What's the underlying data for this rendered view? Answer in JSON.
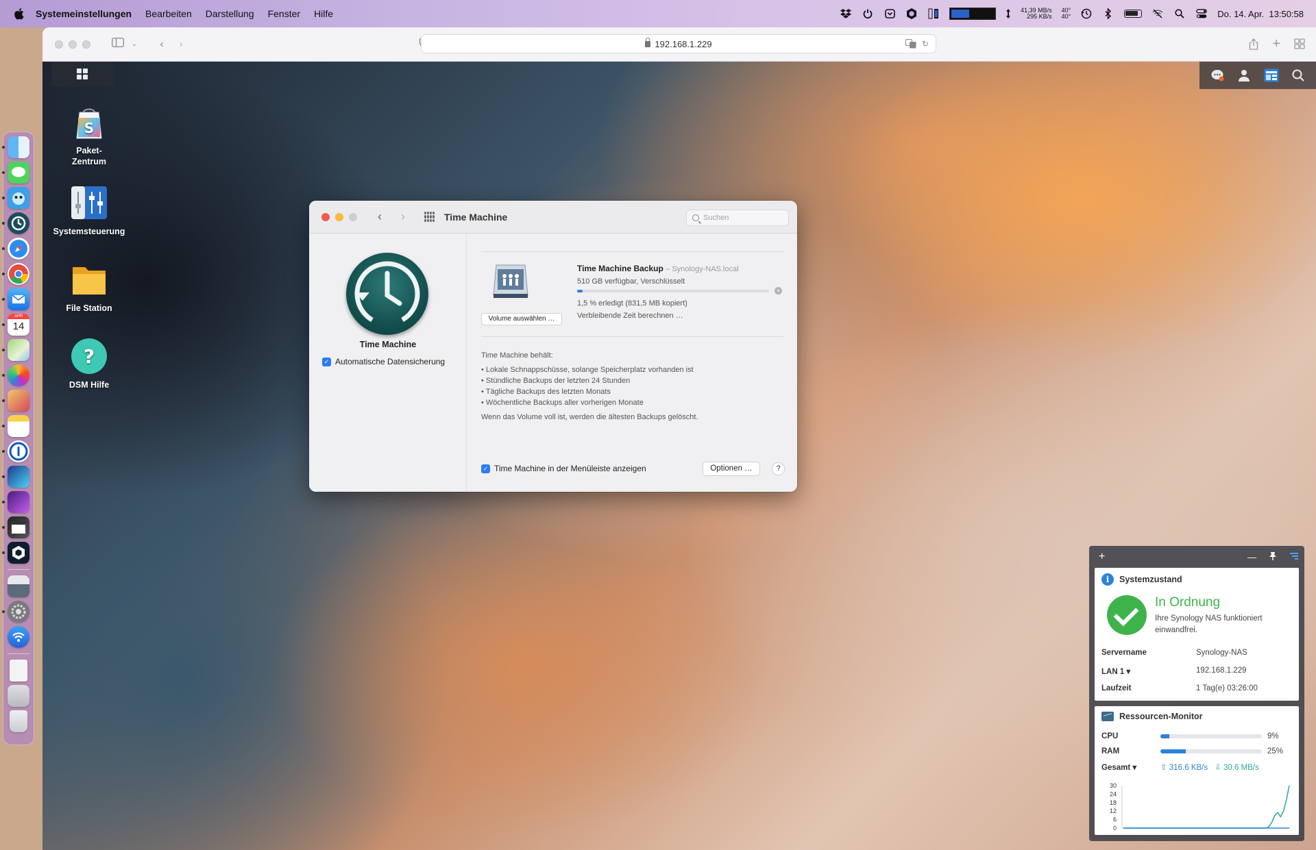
{
  "menubar": {
    "app_name": "Systemeinstellungen",
    "items": [
      "Bearbeiten",
      "Darstellung",
      "Fenster",
      "Hilfe"
    ],
    "net_up": "41,39 MB/s",
    "net_down": "295 KB/s",
    "temp1": "40°",
    "temp2": "40°",
    "datetime": "Do. 14. Apr.  13:50:58"
  },
  "browser": {
    "url": "192.168.1.229"
  },
  "dock": {
    "calendar_day": "14",
    "apps": [
      "finder-icon",
      "messages-icon",
      "tweetbot-icon",
      "time-machine-icon",
      "safari-icon",
      "chrome-icon",
      "mail-icon",
      "calendar-icon",
      "maps-icon",
      "photos-icon",
      "affinity-icon",
      "notes-icon",
      "1password-icon",
      "affinity-designer-icon",
      "affinity-photo-icon",
      "final-cut-icon",
      "sideloader-icon",
      "preview-icon",
      "system-preferences-icon",
      "wifi-icon",
      "document-icon",
      "files-icon",
      "trash-icon"
    ]
  },
  "desktop": {
    "icons": [
      {
        "label": "Paket-\nZentrum",
        "label_line1": "Paket-",
        "label_line2": "Zentrum"
      },
      {
        "label": "Systemsteuerung"
      },
      {
        "label": "File Station"
      },
      {
        "label": "DSM Hilfe"
      }
    ]
  },
  "prefs": {
    "title": "Time Machine",
    "search_placeholder": "Suchen",
    "icon_label": "Time Machine",
    "auto_backup_label": "Automatische Datensicherung",
    "auto_backup_checked": true,
    "volume_button": "Volume auswählen …",
    "backup_name": "Time Machine Backup",
    "backup_host": "– Synology-NAS.local",
    "backup_status": "510 GB verfügbar, Verschlüsselt",
    "progress_percent": 1.5,
    "progress_text": "1,5 % erledigt (831,5 MB kopiert)",
    "remaining_text": "Verbleibende Zeit berechnen …",
    "keeps_label": "Time Machine behält:",
    "keeps_items": [
      "Lokale Schnappschüsse, solange Speicherplatz vorhanden ist",
      "Stündliche Backups der letzten 24 Stunden",
      "Tägliche Backups des letzten Monats",
      "Wöchentliche Backups aller vorherigen Monate"
    ],
    "keeps_note": "Wenn das Volume voll ist, werden die ältesten Backups gelöscht.",
    "menubar_label": "Time Machine in der Menüleiste anzeigen",
    "menubar_checked": true,
    "options_button": "Optionen …",
    "help_button": "?"
  },
  "widgets": {
    "health": {
      "title": "Systemzustand",
      "status": "In Ordnung",
      "description": "Ihre Synology NAS funktioniert einwandfrei.",
      "rows": [
        {
          "key": "Servername",
          "value": "Synology-NAS"
        },
        {
          "key": "LAN 1 ▾",
          "value": "192.168.1.229"
        },
        {
          "key": "Laufzeit",
          "value": "1 Tag(e) 03:26:00"
        }
      ]
    },
    "resources": {
      "title": "Ressourcen-Monitor",
      "cpu_label": "CPU",
      "cpu_percent": 9,
      "cpu_text": "9%",
      "ram_label": "RAM",
      "ram_percent": 25,
      "ram_text": "25%",
      "net_label": "Gesamt ▾",
      "net_up": "316.6 KB/s",
      "net_down": "30.6 MB/s"
    }
  },
  "chart_data": {
    "type": "line",
    "title": "",
    "xlabel": "",
    "ylabel": "",
    "ylim": [
      0,
      30
    ],
    "yticks": [
      30,
      24,
      18,
      12,
      6,
      0
    ],
    "series": [
      {
        "values": [
          0,
          0,
          0,
          0,
          0,
          0,
          0,
          0,
          0,
          0,
          0,
          0,
          0,
          0,
          0,
          0,
          0,
          0,
          0,
          0,
          0,
          0,
          0,
          0,
          0,
          0,
          0,
          0,
          0,
          0,
          0,
          0,
          0,
          0,
          0,
          0,
          0,
          0,
          0,
          0,
          0,
          0,
          0,
          0,
          0,
          0,
          0,
          0,
          0,
          0,
          1,
          4,
          9,
          11,
          8,
          12,
          20,
          30
        ],
        "color": "#2aa8a0"
      },
      {
        "values": [
          0,
          0,
          0,
          0,
          0,
          0,
          0,
          0,
          0,
          0,
          0,
          0,
          0,
          0,
          0,
          0,
          0,
          0,
          0,
          0,
          0,
          0,
          0,
          0,
          0,
          0,
          0,
          0,
          0,
          0,
          0,
          0,
          0,
          0,
          0,
          0,
          0,
          0,
          0,
          0,
          0,
          0,
          0,
          0,
          0,
          0,
          0,
          0,
          0,
          0,
          0,
          0,
          0,
          0,
          0,
          0,
          0,
          0
        ],
        "color": "#2d82d9"
      }
    ]
  }
}
